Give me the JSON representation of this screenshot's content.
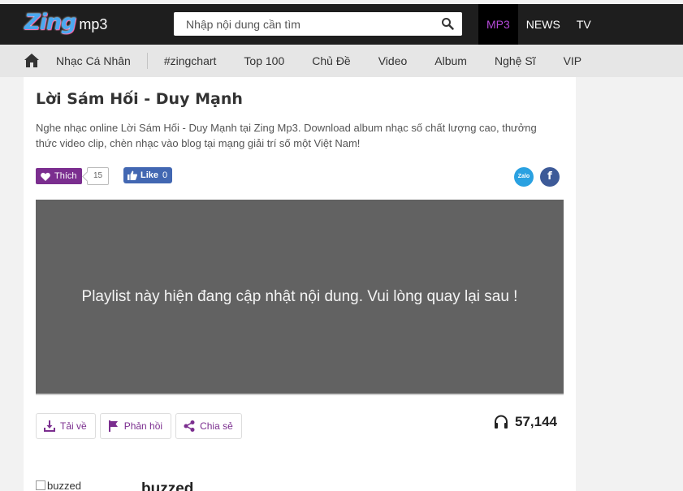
{
  "header": {
    "logo_zing": "Zing",
    "logo_mp3": "mp3",
    "search_placeholder": "Nhập nội dung cần tìm",
    "tabs": [
      {
        "label": "MP3",
        "active": true
      },
      {
        "label": "NEWS",
        "active": false
      },
      {
        "label": "TV",
        "active": false
      }
    ]
  },
  "menu": {
    "items": [
      "Nhạc Cá Nhân",
      "#zingchart",
      "Top 100",
      "Chủ Đề",
      "Video",
      "Album",
      "Nghệ Sĩ",
      "VIP"
    ]
  },
  "page": {
    "title": "Lời Sám Hối - Duy Mạnh",
    "description": "Nghe nhạc online Lời Sám Hối - Duy Mạnh tại Zing Mp3. Download album nhạc số chất lượng cao, thưởng thức video clip, chèn nhạc vào blog tại mạng giải trí số một Việt Nam!",
    "thich_label": "Thích",
    "thich_count": "15",
    "fb_like_label": "Like",
    "fb_like_count": "0",
    "zalo_label": "Zalo",
    "facebook_label": "f",
    "player_message": "Playlist này hiện đang cập nhật nội dung. Vui lòng quay lại sau !",
    "actions": {
      "download": "Tải về",
      "feedback": "Phản hồi",
      "share": "Chia sẻ"
    },
    "listen_count": "57,144",
    "buzzed_alt": "buzzed",
    "buzzed_title": "buzzed"
  },
  "colors": {
    "header_bg": "#1e1e1e",
    "accent_purple": "#7b2e8f",
    "active_tab": "#b449d8",
    "player_bg": "#626262"
  }
}
